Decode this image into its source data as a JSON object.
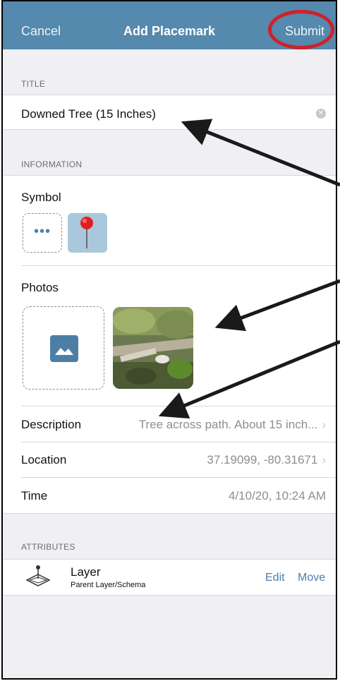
{
  "navbar": {
    "cancel_label": "Cancel",
    "title": "Add Placemark",
    "submit_label": "Submit"
  },
  "sections": {
    "title_header": "TITLE",
    "information_header": "INFORMATION",
    "attributes_header": "ATTRIBUTES"
  },
  "title_field": {
    "value": "Downed Tree (15 Inches)",
    "clear_icon": "clear-circle-icon"
  },
  "symbol": {
    "label": "Symbol",
    "more_glyph": "•••",
    "selected_icon": "red-map-pin-icon"
  },
  "photos": {
    "label": "Photos",
    "add_icon": "add-photo-icon",
    "thumbnail": "photo-thumbnail"
  },
  "description": {
    "label": "Description",
    "value": "Tree across path. About 15 inch..."
  },
  "location": {
    "label": "Location",
    "value": "37.19099, -80.31671"
  },
  "time": {
    "label": "Time",
    "value": "4/10/20, 10:24 AM"
  },
  "layer": {
    "name": "Layer",
    "subtitle": "Parent Layer/Schema",
    "edit_label": "Edit",
    "move_label": "Move",
    "icon": "layer-stack-icon"
  },
  "colors": {
    "navbar": "#5589ad",
    "accent": "#4a7fb0",
    "highlight_circle": "#d0202a",
    "background": "#efeff4"
  }
}
